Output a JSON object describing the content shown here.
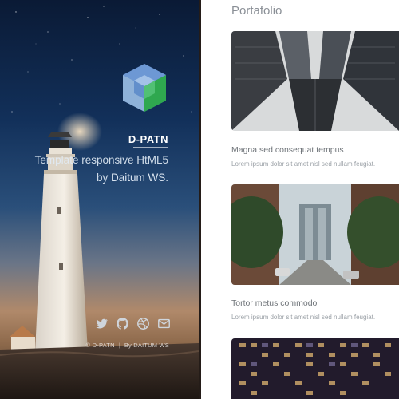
{
  "sidebar": {
    "brand": "D-PATN",
    "tagline_line1": "Template responsive HtML5",
    "tagline_by": "by",
    "tagline_author": "Daitum WS.",
    "social_icons": [
      "twitter-icon",
      "github-icon",
      "dribbble-icon",
      "mail-icon"
    ],
    "footer_copyright": "© D-PATN",
    "footer_separator": "|",
    "footer_credit": "By DAITUM WS"
  },
  "main": {
    "section_title": "Portafolio",
    "cards": [
      {
        "title": "Magna sed consequat tempus",
        "text": "Lorem ipsum dolor sit amet nisl sed nullam feugiat.",
        "image": "skyscrapers-photo"
      },
      {
        "title": "Tortor metus commodo",
        "text": "Lorem ipsum dolor sit amet nisl sed nullam feugiat.",
        "image": "bridge-street-photo"
      },
      {
        "image": "night-building-photo"
      }
    ]
  },
  "colors": {
    "title_gray": "#8a8f96",
    "text_gray": "#9aa0a6",
    "logo_blue": "#4a7fc0",
    "logo_green": "#2fa84f"
  }
}
